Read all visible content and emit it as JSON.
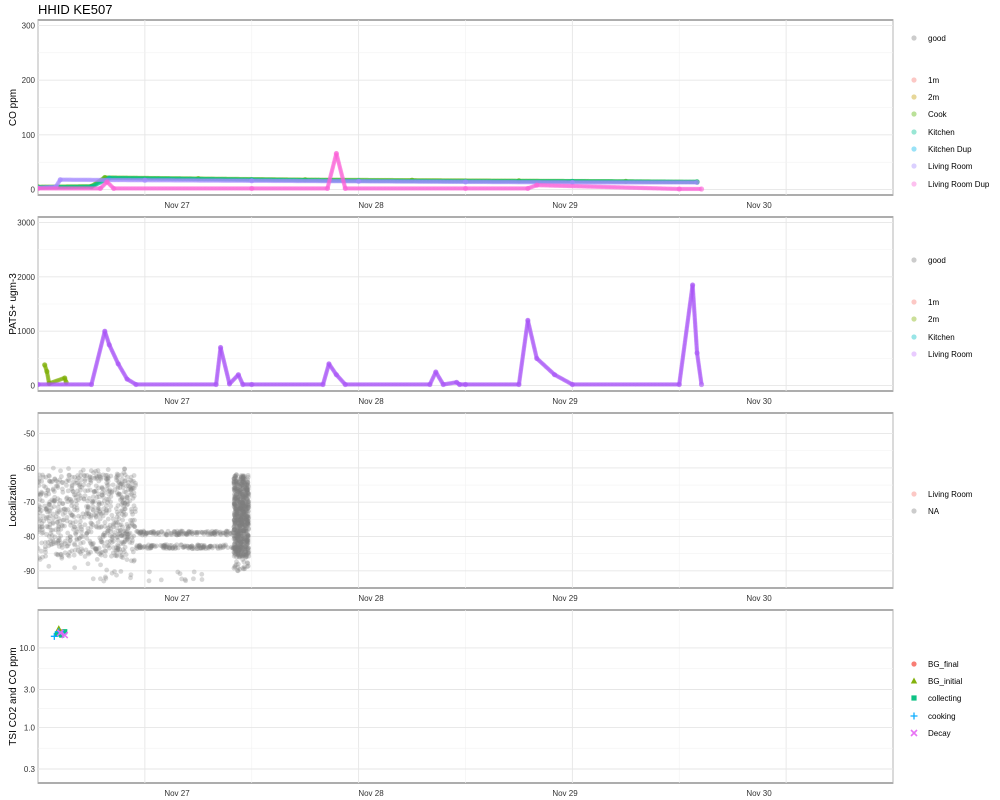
{
  "title": "HHID KE507",
  "chart_data": [
    {
      "type": "scatter",
      "ylabel": "CO ppm",
      "xlim": [
        "2023-11-26T12:00",
        "2023-11-30T12:00"
      ],
      "x_ticks": [
        "Nov 27",
        "Nov 28",
        "Nov 29",
        "Nov 30"
      ],
      "ylim": [
        -10,
        310
      ],
      "y_ticks": [
        0,
        100,
        200,
        300
      ],
      "legend": {
        "groups": [
          {
            "entries": [
              {
                "label": "good",
                "color": "#7f7f7f"
              }
            ]
          },
          {
            "entries": [
              {
                "label": "1m",
                "color": "#F8766D"
              },
              {
                "label": "2m",
                "color": "#C49A00"
              },
              {
                "label": "Cook",
                "color": "#53B400"
              },
              {
                "label": "Kitchen",
                "color": "#00C094"
              },
              {
                "label": "Kitchen Dup",
                "color": "#00B6EB"
              },
              {
                "label": "Living Room",
                "color": "#A58AFF"
              },
              {
                "label": "Living Room Dup",
                "color": "#FB61D7"
              }
            ]
          }
        ]
      },
      "series": [
        {
          "name": "Cook",
          "color": "#53B400",
          "x": [
            "2023-11-26T12:00",
            "2023-11-26T18:00",
            "2023-11-26T19:30",
            "2023-11-27T06:00",
            "2023-11-27T18:00",
            "2023-11-28T06:00",
            "2023-11-28T18:00",
            "2023-11-29T06:00",
            "2023-11-29T14:00"
          ],
          "y": [
            5,
            6,
            22,
            20,
            18,
            17,
            16,
            15,
            14
          ]
        },
        {
          "name": "Kitchen",
          "color": "#00C094",
          "x": [
            "2023-11-26T12:00",
            "2023-11-26T18:00",
            "2023-11-26T20:00",
            "2023-11-27T12:00",
            "2023-11-28T00:00",
            "2023-11-28T12:00",
            "2023-11-29T00:00",
            "2023-11-29T14:00"
          ],
          "y": [
            4,
            5,
            21,
            18,
            16,
            15,
            15,
            14
          ]
        },
        {
          "name": "Living Room",
          "color": "#A58AFF",
          "x": [
            "2023-11-26T12:00",
            "2023-11-26T14:00",
            "2023-11-26T14:30",
            "2023-11-27T00:00",
            "2023-11-27T12:00",
            "2023-11-28T00:00",
            "2023-11-28T12:00",
            "2023-11-29T00:00",
            "2023-11-29T14:00"
          ],
          "y": [
            3,
            5,
            18,
            17,
            16,
            15,
            14,
            13,
            13
          ]
        },
        {
          "name": "Living Room Dup",
          "color": "#FB61D7",
          "x": [
            "2023-11-26T12:00",
            "2023-11-26T19:00",
            "2023-11-26T19:45",
            "2023-11-26T20:30",
            "2023-11-27T12:00",
            "2023-11-27T20:30",
            "2023-11-27T21:30",
            "2023-11-27T22:30",
            "2023-11-28T12:00",
            "2023-11-28T19:00",
            "2023-11-28T20:00",
            "2023-11-29T12:00",
            "2023-11-29T14:30"
          ],
          "y": [
            2,
            2,
            14,
            2,
            2,
            2,
            66,
            2,
            2,
            2,
            8,
            1,
            1
          ]
        }
      ]
    },
    {
      "type": "scatter",
      "ylabel": "PATS+ ugm-3",
      "xlim": [
        "2023-11-26T12:00",
        "2023-11-30T12:00"
      ],
      "x_ticks": [
        "Nov 27",
        "Nov 28",
        "Nov 29",
        "Nov 30"
      ],
      "ylim": [
        -100,
        3100
      ],
      "y_ticks": [
        0,
        1000,
        2000,
        3000
      ],
      "legend": {
        "groups": [
          {
            "entries": [
              {
                "label": "good",
                "color": "#7f7f7f"
              }
            ]
          },
          {
            "entries": [
              {
                "label": "1m",
                "color": "#F8766D"
              },
              {
                "label": "2m",
                "color": "#7CAE00"
              },
              {
                "label": "Kitchen",
                "color": "#00BFC4"
              },
              {
                "label": "Living Room",
                "color": "#C77CFF"
              }
            ]
          }
        ]
      },
      "series": [
        {
          "name": "2m",
          "color": "#7CAE00",
          "x": [
            "2023-11-26T12:45",
            "2023-11-26T13:00",
            "2023-11-26T13:15",
            "2023-11-26T15:00",
            "2023-11-26T15:10"
          ],
          "y": [
            380,
            260,
            40,
            140,
            60
          ]
        },
        {
          "name": "Living Room",
          "color": "#A855F7",
          "x": [
            "2023-11-26T12:00",
            "2023-11-26T18:00",
            "2023-11-26T19:30",
            "2023-11-26T20:00",
            "2023-11-26T21:00",
            "2023-11-26T22:00",
            "2023-11-26T23:00",
            "2023-11-27T08:00",
            "2023-11-27T08:30",
            "2023-11-27T09:30",
            "2023-11-27T10:30",
            "2023-11-27T11:00",
            "2023-11-27T12:00",
            "2023-11-27T20:00",
            "2023-11-27T20:40",
            "2023-11-27T21:30",
            "2023-11-27T22:30",
            "2023-11-28T08:00",
            "2023-11-28T08:40",
            "2023-11-28T09:30",
            "2023-11-28T11:00",
            "2023-11-28T11:20",
            "2023-11-28T12:00",
            "2023-11-28T18:00",
            "2023-11-28T19:00",
            "2023-11-28T20:00",
            "2023-11-28T22:00",
            "2023-11-29T00:00",
            "2023-11-29T12:00",
            "2023-11-29T13:30",
            "2023-11-29T14:00",
            "2023-11-29T14:30"
          ],
          "y": [
            20,
            20,
            1000,
            750,
            400,
            120,
            20,
            20,
            700,
            30,
            200,
            20,
            20,
            20,
            400,
            200,
            20,
            20,
            250,
            20,
            60,
            20,
            20,
            20,
            1200,
            500,
            200,
            20,
            20,
            1850,
            600,
            20
          ]
        }
      ]
    },
    {
      "type": "scatter",
      "ylabel": "Localization",
      "xlim": [
        "2023-11-26T12:00",
        "2023-11-30T12:00"
      ],
      "x_ticks": [
        "Nov 27",
        "Nov 28",
        "Nov 29",
        "Nov 30"
      ],
      "ylim": [
        -95,
        -44
      ],
      "y_ticks": [
        -90,
        -80,
        -70,
        -60,
        -50
      ],
      "legend": {
        "groups": [
          {
            "entries": [
              {
                "label": "Living Room",
                "color": "#F8766D"
              },
              {
                "label": "NA",
                "color": "#7f7f7f"
              }
            ]
          }
        ]
      },
      "scatter_cloud": {
        "name": "NA",
        "color": "#7f7f7f",
        "x_range": [
          "2023-11-26T12:00",
          "2023-11-27T11:40"
        ],
        "y_range": [
          -93,
          -60
        ],
        "bands": [
          {
            "x_range": [
              "2023-11-26T12:00",
              "2023-11-26T23:00"
            ],
            "y_range": [
              -93,
              -60
            ]
          },
          {
            "x_range": [
              "2023-11-26T23:00",
              "2023-11-27T10:00"
            ],
            "y_values": [
              -79,
              -83
            ]
          },
          {
            "x_range": [
              "2023-11-27T10:00",
              "2023-11-27T11:40"
            ],
            "y_range": [
              -90,
              -66
            ]
          }
        ]
      }
    },
    {
      "type": "scatter",
      "ylabel": "TSI CO2 and CO ppm",
      "xlim": [
        "2023-11-26T12:00",
        "2023-11-30T12:00"
      ],
      "x_ticks": [
        "Nov 27",
        "Nov 28",
        "Nov 29",
        "Nov 30"
      ],
      "y_scale": "log10",
      "ylim": [
        0.2,
        30
      ],
      "y_ticks": [
        "0.3",
        "1.0",
        "3.0",
        "10.0"
      ],
      "legend": {
        "groups": [
          {
            "entries": [
              {
                "label": "BG_final",
                "color": "#F8766D",
                "shape": "circle"
              },
              {
                "label": "BG_initial",
                "color": "#7CAE00",
                "shape": "triangle"
              },
              {
                "label": "collecting",
                "color": "#00BF7D",
                "shape": "square"
              },
              {
                "label": "cooking",
                "color": "#00A9FF",
                "shape": "plus"
              },
              {
                "label": "Decay",
                "color": "#E76BF3",
                "shape": "cross"
              }
            ]
          }
        ]
      },
      "series": [
        {
          "name": "BG_final",
          "color": "#F8766D",
          "shape": "circle",
          "x": [
            "2023-11-26T14:40"
          ],
          "y": [
            16
          ]
        },
        {
          "name": "BG_initial",
          "color": "#7CAE00",
          "shape": "triangle",
          "x": [
            "2023-11-26T14:20"
          ],
          "y": [
            17.5
          ]
        },
        {
          "name": "collecting",
          "color": "#00BF7D",
          "shape": "square",
          "x": [
            "2023-11-26T14:10",
            "2023-11-26T14:40",
            "2023-11-26T15:00"
          ],
          "y": [
            15,
            14.5,
            16
          ]
        },
        {
          "name": "cooking",
          "color": "#00A9FF",
          "shape": "plus",
          "x": [
            "2023-11-26T13:50",
            "2023-11-26T14:20",
            "2023-11-26T14:50"
          ],
          "y": [
            14,
            16,
            15
          ]
        },
        {
          "name": "Decay",
          "color": "#E76BF3",
          "shape": "cross",
          "x": [
            "2023-11-26T14:30",
            "2023-11-26T15:00"
          ],
          "y": [
            15.5,
            14.5
          ]
        }
      ]
    }
  ]
}
